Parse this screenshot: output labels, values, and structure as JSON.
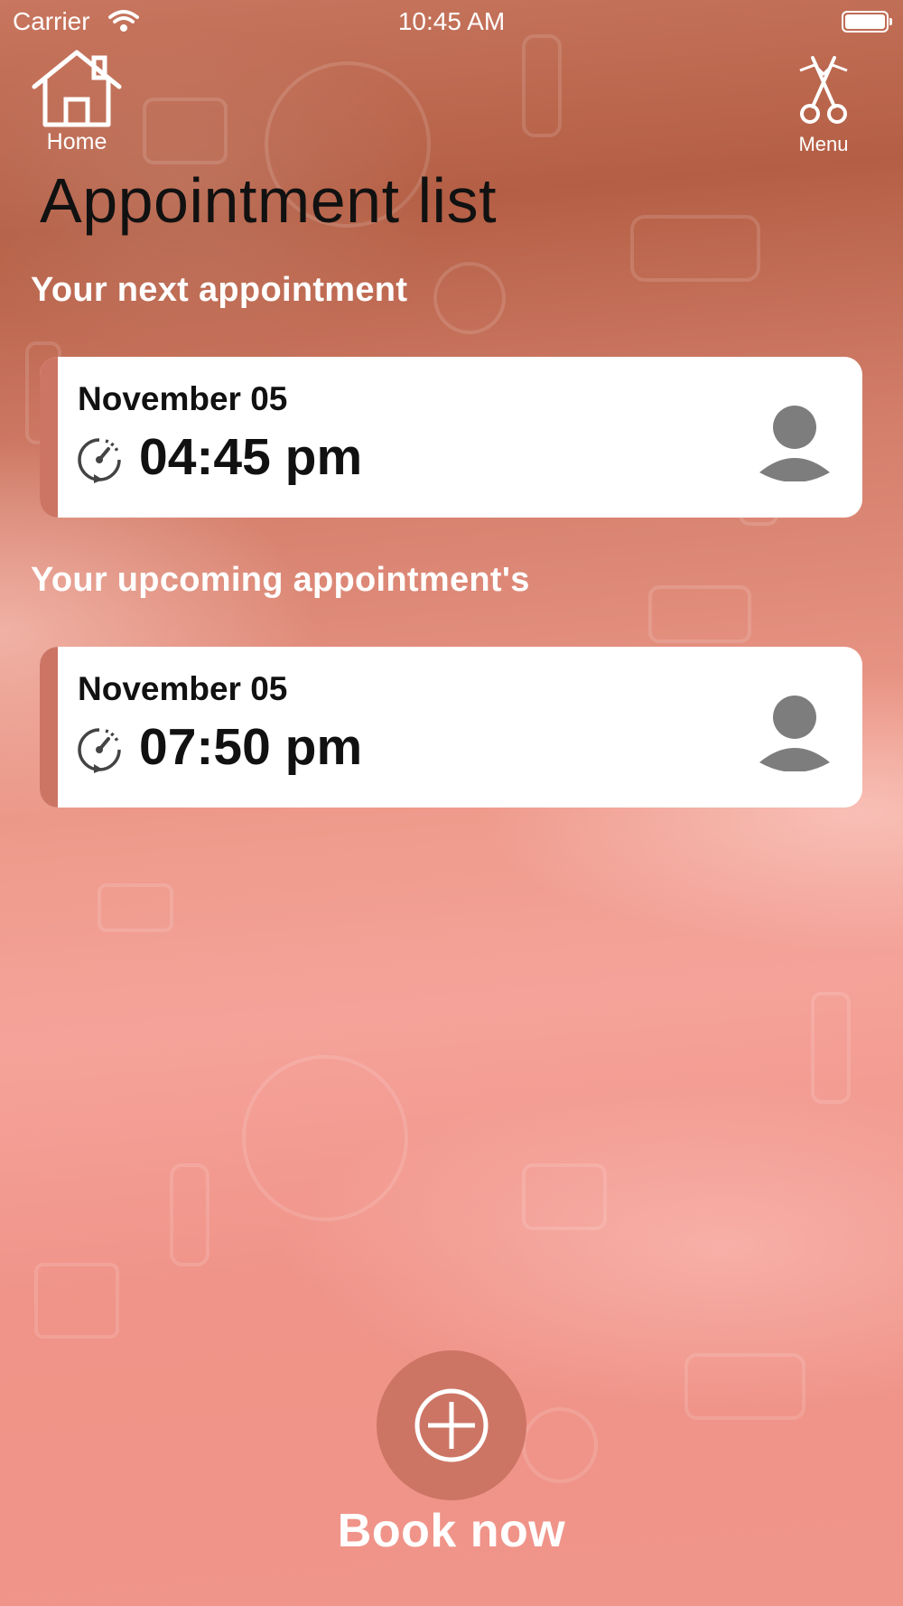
{
  "status_bar": {
    "carrier": "Carrier",
    "time": "10:45 AM"
  },
  "nav": {
    "home_label": "Home",
    "menu_label": "Menu"
  },
  "page": {
    "title": "Appointment list"
  },
  "next_section": {
    "label": "Your next appointment",
    "appointment": {
      "date": "November 05",
      "time": "04:45 pm"
    }
  },
  "upcoming_section": {
    "label": "Your upcoming appointment's",
    "appointments": [
      {
        "date": "November 05",
        "time": "07:50 pm"
      }
    ]
  },
  "book": {
    "label": "Book now"
  },
  "colors": {
    "accent": "#cd7565",
    "card": "#ffffff",
    "title": "#111111"
  },
  "icons": {
    "home": "house-icon",
    "menu": "scissors-icon",
    "clock": "clock-icon",
    "avatar": "user-avatar-icon",
    "book": "plus-circle-icon"
  }
}
